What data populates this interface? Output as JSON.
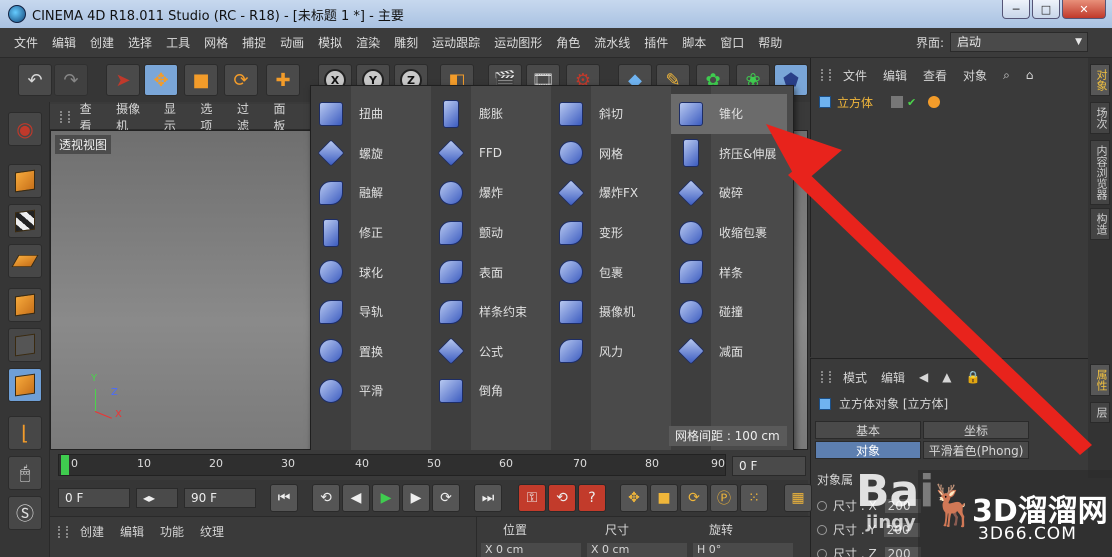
{
  "window": {
    "title": "CINEMA 4D R18.011 Studio (RC - R18) - [未标题 1 *] - 主要",
    "minimize": "─",
    "maximize": "□",
    "close": "✕"
  },
  "menubar": {
    "items": [
      "文件",
      "编辑",
      "创建",
      "选择",
      "工具",
      "网格",
      "捕捉",
      "动画",
      "模拟",
      "渲染",
      "雕刻",
      "运动跟踪",
      "运动图形",
      "角色",
      "流水线",
      "插件",
      "脚本",
      "窗口",
      "帮助"
    ],
    "layout_label": "界面:",
    "layout_value": "启动"
  },
  "viewport": {
    "menu": [
      "查看",
      "摄像机",
      "显示",
      "选项",
      "过滤",
      "面板"
    ],
    "label": "透视视图",
    "axes": {
      "x": "X",
      "y": "Y",
      "z": "Z"
    }
  },
  "deformer_popup": {
    "columns": [
      [
        "扭曲",
        "螺旋",
        "融解",
        "修正",
        "球化",
        "导轨",
        "置换",
        "平滑"
      ],
      [
        "膨胀",
        "FFD",
        "爆炸",
        "颤动",
        "表面",
        "样条约束",
        "公式",
        "倒角"
      ],
      [
        "斜切",
        "网格",
        "爆炸FX",
        "变形",
        "包裹",
        "摄像机",
        "风力"
      ],
      [
        "锥化",
        "挤压&伸展",
        "破碎",
        "收缩包裹",
        "样条",
        "碰撞",
        "减面"
      ]
    ],
    "highlighted": "锥化",
    "grid_spacing": "网格间距 : 100 cm"
  },
  "object_manager": {
    "menu": [
      "文件",
      "编辑",
      "查看",
      "对象"
    ],
    "object_name": "立方体"
  },
  "right_tabs": [
    "对象",
    "场次",
    "内容浏览器",
    "构造"
  ],
  "attr_tabs": [
    "属性",
    "层"
  ],
  "attributes": {
    "menu": [
      "模式",
      "编辑"
    ],
    "title": "立方体对象 [立方体]",
    "tabs": [
      "基本",
      "坐标",
      "对象",
      "平滑着色(Phong)"
    ],
    "selected_tab": "对象",
    "section": "对象属",
    "fields": [
      {
        "label": "尺寸 . X",
        "value": "200"
      },
      {
        "label": "尺寸 . Y",
        "value": "200"
      },
      {
        "label": "尺寸 . Z",
        "value": "200"
      }
    ]
  },
  "timeline": {
    "ticks": [
      "0",
      "10",
      "20",
      "30",
      "40",
      "50",
      "60",
      "70",
      "80",
      "90"
    ],
    "current_frame": "0 F",
    "start_frame": "0 F",
    "end_frame": "90 F"
  },
  "bottom": {
    "material_menu": [
      "创建",
      "编辑",
      "功能",
      "纹理"
    ],
    "coord_headers": [
      "位置",
      "尺寸",
      "旋转"
    ],
    "coord_cells": [
      "X  0 cm",
      "X  0 cm",
      "H  0°"
    ]
  },
  "watermark": {
    "brand_cn": "3D溜溜网",
    "brand_url": "3D66.COM",
    "baidu": "Bai",
    "baidu_sub": "jingy"
  },
  "colors": {
    "accent_blue": "#7aa6d8",
    "object_name": "#f0b63a",
    "play_green": "#3fcc4f",
    "arrow_red": "#e8231c"
  }
}
